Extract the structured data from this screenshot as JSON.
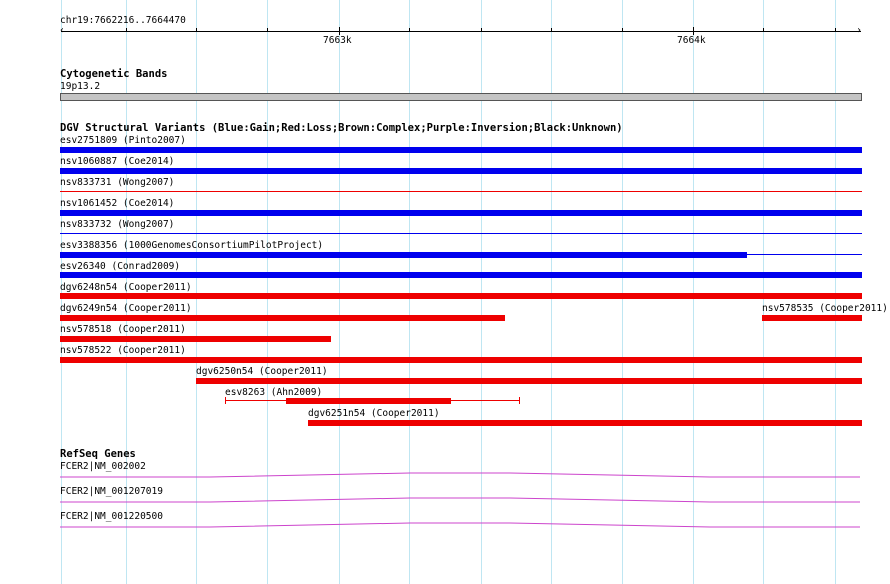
{
  "ruler": {
    "region": "chr19:7662216..7664470",
    "tick_labels": [
      "7663k",
      "7664k"
    ]
  },
  "cytoband": {
    "title": "Cytogenetic Bands",
    "band": "19p13.2"
  },
  "dgv": {
    "title": "DGV Structural Variants (Blue:Gain;Red:Loss;Brown:Complex;Purple:Inversion;Black:Unknown)",
    "colors": {
      "gain": "#0000ee",
      "loss": "#ee0000"
    },
    "variants": [
      {
        "label": "esv2751809 (Pinto2007)"
      },
      {
        "label": "nsv1060887 (Coe2014)"
      },
      {
        "label": "nsv833731 (Wong2007)"
      },
      {
        "label": "nsv1061452 (Coe2014)"
      },
      {
        "label": "nsv833732 (Wong2007)"
      },
      {
        "label": "esv3388356 (1000GenomesConsortiumPilotProject)"
      },
      {
        "label": "esv26340 (Conrad2009)"
      },
      {
        "label": "dgv6248n54 (Cooper2011)"
      },
      {
        "label": "dgv6249n54 (Cooper2011)"
      },
      {
        "label": "nsv578535 (Cooper2011)"
      },
      {
        "label": "nsv578518 (Cooper2011)"
      },
      {
        "label": "nsv578522 (Cooper2011)"
      },
      {
        "label": "dgv6250n54 (Cooper2011)"
      },
      {
        "label": "esv8263 (Ahn2009)"
      },
      {
        "label": "dgv6251n54 (Cooper2011)"
      }
    ]
  },
  "refseq": {
    "title": "RefSeq Genes",
    "color": "#cc44cc",
    "genes": [
      {
        "label": "FCER2|NM_002002"
      },
      {
        "label": "FCER2|NM_001207019"
      },
      {
        "label": "FCER2|NM_001220500"
      }
    ]
  }
}
